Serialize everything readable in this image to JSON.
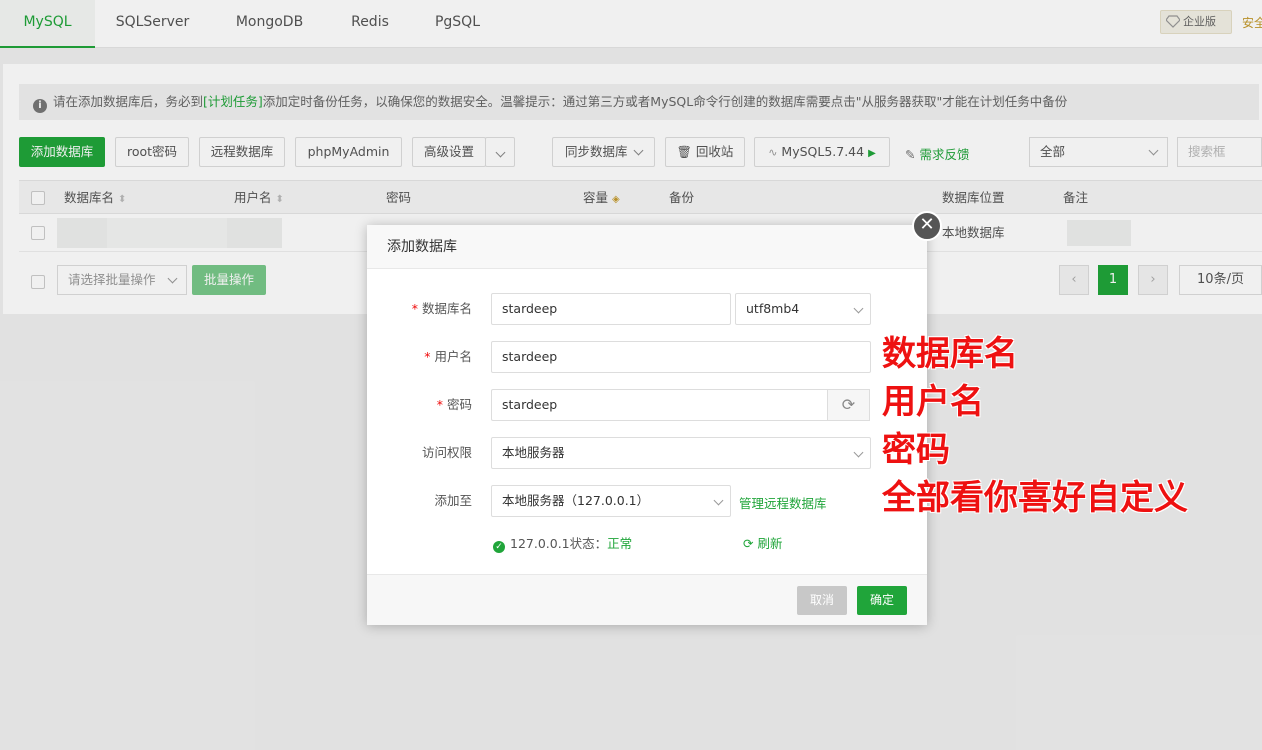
{
  "tabs": [
    {
      "label": "MySQL",
      "active": true
    },
    {
      "label": "SQLServer"
    },
    {
      "label": "MongoDB"
    },
    {
      "label": "Redis"
    },
    {
      "label": "PgSQL"
    }
  ],
  "header_right": {
    "enterprise": "企业版",
    "safe": "安全"
  },
  "tip": {
    "before": "请在添加数据库后，务必到",
    "link": "[计划任务]",
    "after": "添加定时备份任务，以确保您的数据安全。温馨提示：通过第三方或者MySQL命令行创建的数据库需要点击\"从服务器获取\"才能在计划任务中备份"
  },
  "toolbar": {
    "add_db": "添加数据库",
    "root_pwd": "root密码",
    "remote_db": "远程数据库",
    "phpmyadmin": "phpMyAdmin",
    "advanced": "高级设置",
    "sync_db": "同步数据库",
    "recycle": "回收站",
    "mysql_version": "MySQL5.7.44",
    "feedback": "需求反馈",
    "filter_all": "全部",
    "search_placeholder": "搜索框"
  },
  "table": {
    "headers": [
      "数据库名",
      "用户名",
      "密码",
      "容量",
      "备份",
      "数据库位置",
      "备注"
    ],
    "row_location": "本地数据库"
  },
  "footer": {
    "batch_select": "请选择批量操作",
    "batch_btn": "批量操作",
    "page": "1",
    "per_page": "10条/页"
  },
  "dialog": {
    "title": "添加数据库",
    "db_name_label": "数据库名",
    "db_name": "stardeep",
    "charset": "utf8mb4",
    "user_label": "用户名",
    "user": "stardeep",
    "pwd_label": "密码",
    "pwd": "stardeep",
    "access_label": "访问权限",
    "access": "本地服务器",
    "add_to_label": "添加至",
    "add_to": "本地服务器（127.0.0.1）",
    "manage_remote": "管理远程数据库",
    "status_prefix": "127.0.0.1状态：",
    "status": "正常",
    "refresh": "刷新",
    "cancel": "取消",
    "confirm": "确定"
  },
  "annotation": [
    "数据库名",
    "用户名",
    "密码",
    "全部看你喜好自定义"
  ],
  "colors": {
    "accent": "#20a53a",
    "annotation": "#ee1111"
  }
}
